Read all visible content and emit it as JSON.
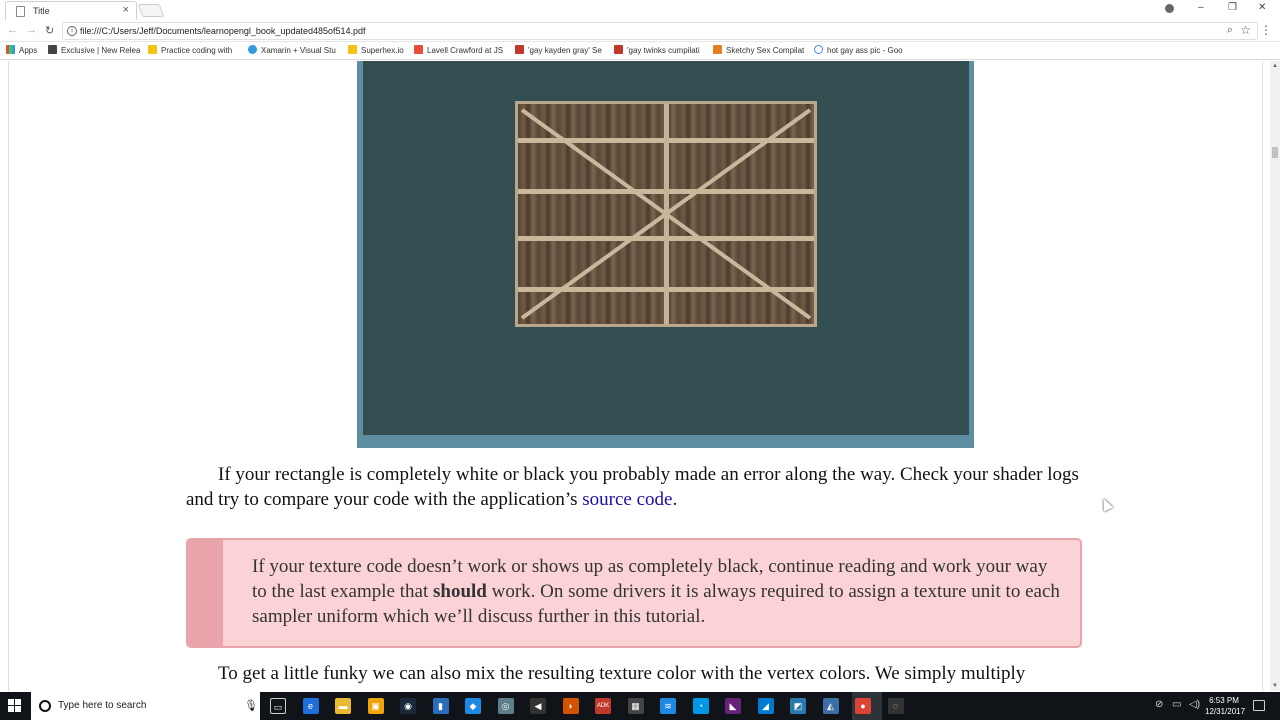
{
  "browser": {
    "tab_title": "Title",
    "tab_close": "×",
    "url": "file:///C:/Users/Jeff/Documents/learnopengl_book_updated485of514.pdf",
    "window_controls": {
      "minimize": "–",
      "restore": "❐",
      "close": "✕"
    },
    "nav": {
      "back": "←",
      "forward": "→",
      "reload": "↻"
    }
  },
  "bookmarks": [
    {
      "label": "Apps",
      "color": "#e74c3c"
    },
    {
      "label": "Exclusive | New Relea",
      "color": "#444444"
    },
    {
      "label": "Practice coding with",
      "color": "#f1c40f"
    },
    {
      "label": "Xamarin + Visual Stu",
      "color": "#3498db"
    },
    {
      "label": "Superhex.io",
      "color": "#f1c40f"
    },
    {
      "label": "Lavell Crawford at JS",
      "color": "#e74c3c"
    },
    {
      "label": "'gay kayden gray' Se",
      "color": "#c0392b"
    },
    {
      "label": "'gay twinks cumpilati",
      "color": "#c0392b"
    },
    {
      "label": "Sketchy Sex Compilat",
      "color": "#e67e22"
    },
    {
      "label": "hot gay ass pic - Goo",
      "color": "#4285f4"
    }
  ],
  "pdf": {
    "paragraph1": {
      "text": "If your rectangle is completely white or black you probably made an error along the way. Check your shader logs and try to compare your code with the application’s",
      "link": "source code",
      "end": "."
    },
    "note": {
      "before": "If your texture code doesn’t work or shows up as completely black, continue reading and work your way to the last example that",
      "bold": "should",
      "after": "work. On some drivers it is always required to assign a texture unit to each sampler uniform which we’ll discuss further in this tutorial."
    },
    "paragraph2": "To get a little funky we can also mix the resulting texture color with the vertex colors. We simply multiply"
  },
  "taskbar": {
    "search_placeholder": "Type here to search",
    "time": "6:53 PM",
    "date": "12/31/2017",
    "icons": [
      {
        "name": "task-view-icon",
        "glyph": "▭",
        "color": "transparent"
      },
      {
        "name": "edge-icon",
        "glyph": "e",
        "color": "#1e6fd9"
      },
      {
        "name": "file-explorer-icon",
        "glyph": "▬",
        "color": "#e8b931"
      },
      {
        "name": "store-icon",
        "glyph": "▣",
        "color": "#f0a30a"
      },
      {
        "name": "steam-icon",
        "glyph": "◉",
        "color": "#1b2838"
      },
      {
        "name": "app-icon-1",
        "glyph": "▮",
        "color": "#2a6ebb"
      },
      {
        "name": "app-icon-2",
        "glyph": "◆",
        "color": "#1e88e5"
      },
      {
        "name": "app-icon-3",
        "glyph": "◎",
        "color": "#607d8b"
      },
      {
        "name": "app-icon-4",
        "glyph": "◀",
        "color": "#333333"
      },
      {
        "name": "app-icon-5",
        "glyph": "◗",
        "color": "#d35400"
      },
      {
        "name": "adk-icon",
        "glyph": "ADK",
        "color": "#c0392b"
      },
      {
        "name": "calculator-icon",
        "glyph": "▦",
        "color": "#444444"
      },
      {
        "name": "app-icon-6",
        "glyph": "≋",
        "color": "#1e88e5"
      },
      {
        "name": "app-icon-7",
        "glyph": "◔",
        "color": "#0097e6"
      },
      {
        "name": "visual-studio-icon",
        "glyph": "◣",
        "color": "#68217a"
      },
      {
        "name": "vscode-icon",
        "glyph": "◢",
        "color": "#007acc"
      },
      {
        "name": "app-icon-8",
        "glyph": "◩",
        "color": "#2a7ab0"
      },
      {
        "name": "app-icon-9",
        "glyph": "◭",
        "color": "#3a6ea5"
      },
      {
        "name": "chrome-icon",
        "glyph": "●",
        "color": "#db4437"
      },
      {
        "name": "app-icon-10",
        "glyph": "◌",
        "color": "#333333"
      }
    ]
  }
}
